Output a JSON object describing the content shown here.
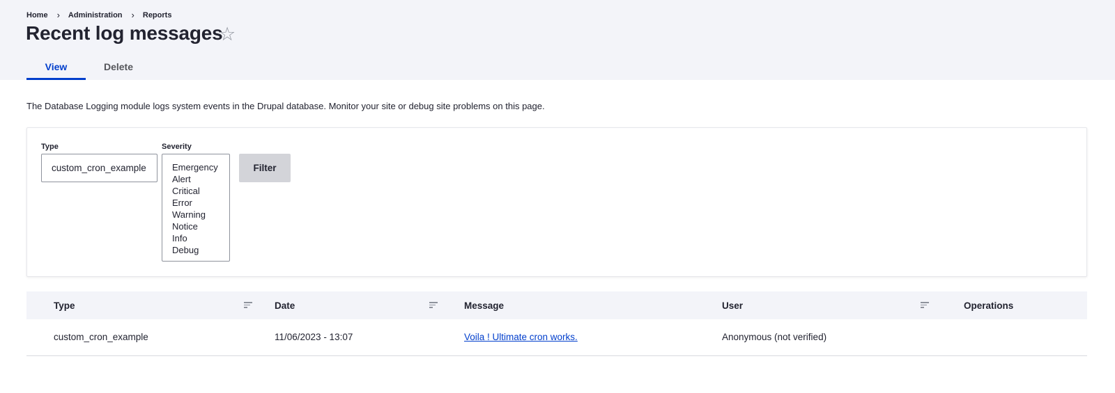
{
  "breadcrumb": {
    "items": [
      "Home",
      "Administration",
      "Reports"
    ],
    "separator": "›"
  },
  "page_title": "Recent log messages",
  "favorite_icon": "star-outline-icon",
  "tabs": [
    {
      "label": "View",
      "active": true
    },
    {
      "label": "Delete",
      "active": false
    }
  ],
  "description": "The Database Logging module logs system events in the Drupal database. Monitor your site or debug site problems on this page.",
  "filter": {
    "type_label": "Type",
    "type_value": "custom_cron_example",
    "severity_label": "Severity",
    "severity_options": [
      "Emergency",
      "Alert",
      "Critical",
      "Error",
      "Warning",
      "Notice",
      "Info",
      "Debug"
    ],
    "button_label": "Filter"
  },
  "table": {
    "headers": [
      "Type",
      "Date",
      "Message",
      "User",
      "Operations"
    ],
    "sortable_icon": "sort-icon",
    "rows": [
      {
        "type": "custom_cron_example",
        "date": "11/06/2023 - 13:07",
        "message": "Voila ! Ultimate cron works.",
        "user": "Anonymous (not verified)",
        "operations": ""
      }
    ]
  },
  "colors": {
    "accent": "#003ecc",
    "header_bg": "#f3f4f9",
    "button_bg": "#d3d4d9",
    "text": "#222330"
  }
}
